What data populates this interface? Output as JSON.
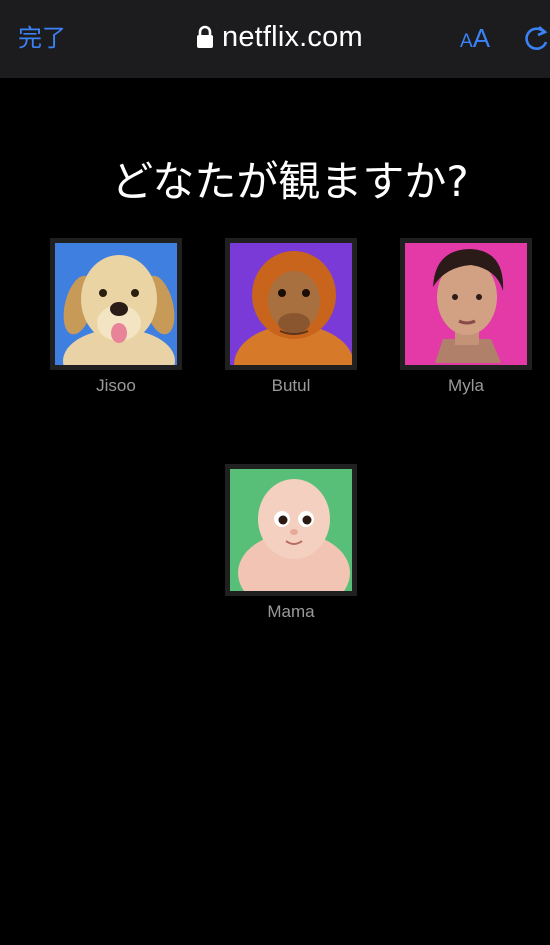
{
  "browser": {
    "done_label": "完了",
    "url": "netflix.com",
    "text_size_small": "A",
    "text_size_large": "A"
  },
  "page": {
    "title": "どなたが観ますか?"
  },
  "profiles": [
    {
      "name": "Jisoo",
      "avatar": "golden-retriever-dog",
      "bg": "#3f7fe0"
    },
    {
      "name": "Butul",
      "avatar": "orangutan",
      "bg": "#7a3ad8"
    },
    {
      "name": "Myla",
      "avatar": "woman-portrait",
      "bg": "#e43aa8"
    },
    {
      "name": "Mama",
      "avatar": "cartoon-baby",
      "bg": "#58bf78"
    }
  ],
  "colors": {
    "accent": "#3b82f6",
    "background": "#000000",
    "topbar": "#1c1c1e",
    "profile_name": "#9a9a9a"
  }
}
